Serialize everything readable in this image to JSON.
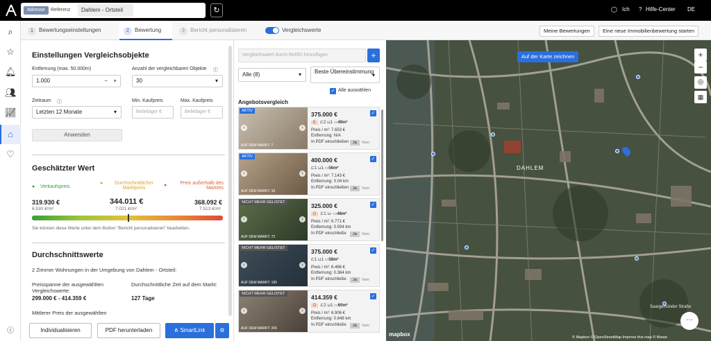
{
  "topbar": {
    "seg_adresse": "Adresse",
    "seg_referenz": "Referenz",
    "location": "Dahlem - Ortsteil",
    "user": "Ich",
    "help": "Hilfe-Center",
    "lang": "DE"
  },
  "tabs": [
    {
      "num": "1",
      "label": "Bewertungseinstellungen"
    },
    {
      "num": "2",
      "label": "Bewertung"
    },
    {
      "num": "3",
      "label": "Bericht personalisieren"
    }
  ],
  "toggle_label": "Vergleichswerte",
  "top_buttons": {
    "my": "Meine Bewertungen",
    "new": "Eine neue Immobilienbewertung starten"
  },
  "settings": {
    "title": "Einstellungen Vergleichsobjekte",
    "distance_label": "Entfernung (max. 50.000m)",
    "distance_value": "1.000",
    "count_label": "Anzahl der vergleichbaren Objekte",
    "count_value": "30",
    "period_label": "Zeitraum",
    "period_value": "Letzten 12 Monate",
    "min_label": "Min. Kaufpreis",
    "max_label": "Max. Kaufpreis",
    "min_ph": "Beliebiger €",
    "max_ph": "Beliebiger €",
    "apply": "Anwenden"
  },
  "value": {
    "title": "Geschätzter Wert",
    "sale_label": "Verkaufspreis",
    "avg_label": "Durchschnittlicher Marktpreis",
    "out_label": "Preis außerhalb des Marktes",
    "sale_value": "319.930 €",
    "sale_sqm": "6.530 €/m²",
    "avg_value": "344.011 €",
    "avg_sqm": "7.021 €/m²",
    "out_value": "368.092 €",
    "out_sqm": "7.513 €/m²",
    "hint": "Sie können diese Werte unter dem Button \"Bericht personalisieren\" bearbeiten.",
    "position_fraction": 0.5
  },
  "averages": {
    "title": "Durchschnittswerte",
    "subtitle": "2 Zimmer Wohnungen in der Umgebung von Dahlem - Ortsteil:",
    "span_label": "Preisspanne der ausgewählten Vergleichswerte:",
    "span_value": "299.000 € - 414.359 €",
    "time_label": "Durchschnittliche Zeit auf dem Markt:",
    "time_value": "127 Tage",
    "mean_label": "Mittlerer Preis der ausgewählten"
  },
  "bottom": {
    "individual": "Individualisieren",
    "pdf": "PDF herunterladen",
    "smart": "SmartLink"
  },
  "list": {
    "add_ph": "Vergleichswert durch Ref/ID hinzufügen",
    "filter": "Alle (8)",
    "sort": "Beste Übereinstimmung",
    "select_all": "Alle auswählen",
    "heading": "Angebotsvergleich",
    "items": [
      {
        "badge": "AKTIV",
        "market": "AUF DEM MARKT: 7",
        "price": "375.000 €",
        "energy": "E",
        "rooms": "2",
        "baths": "1",
        "area": "49m²",
        "sqm": "Preis / m²: 7.653 €",
        "dist": "Entfernung: N/A",
        "pdf": "In PDF einschließen",
        "ja": "Ja",
        "nein": "Nein"
      },
      {
        "badge": "AKTIV",
        "market": "AUF DEM MARKT: 18",
        "price": "400.000 €",
        "energy": "",
        "rooms": "1",
        "baths": "1",
        "area": "56m²",
        "sqm": "Preis / m²: 7.143 €",
        "dist": "Entfernung: 0.04 km",
        "pdf": "In PDF einschließen",
        "ja": "Ja",
        "nein": "Nein"
      },
      {
        "badge": "NICHT MEHR GELISTET",
        "market": "AUF DEM MARKT: 72",
        "price": "325.000 €",
        "energy": "D",
        "rooms": "1",
        "baths": "-",
        "area": "48m²",
        "sqm": "Preis / m²: 6.771 €",
        "dist": "Entfernung: 0.934 km",
        "pdf": "In PDF einschließe",
        "ja": "Ja",
        "nein": "Nein"
      },
      {
        "badge": "NICHT MEHR GELISTET",
        "market": "AUF DEM MARKT: 195",
        "price": "375.000 €",
        "energy": "",
        "rooms": "1",
        "baths": "1",
        "area": "58m²",
        "sqm": "Preis / m²: 6.466 €",
        "dist": "Entfernung: 0.364 km",
        "pdf": "In PDF einschließe",
        "ja": "Ja",
        "nein": "Nein"
      },
      {
        "badge": "NICHT MEHR GELISTET",
        "market": "AUF DEM MARKT: 206",
        "price": "414.359 €",
        "energy": "D",
        "rooms": "2",
        "baths": "1",
        "area": "60m²",
        "sqm": "Preis / m²: 6.906 €",
        "dist": "Entfernung: 0.648 km",
        "pdf": "In PDF einschließe",
        "ja": "Ja",
        "nein": "Nein"
      }
    ]
  },
  "map": {
    "draw": "Auf der Karte zeichnen",
    "area_label": "DAHLEM",
    "attribution": "© Mapbox © OpenStreetMap Improve this map © Maxar",
    "logo": "mapbox",
    "street": "Saargemünder Straße"
  }
}
